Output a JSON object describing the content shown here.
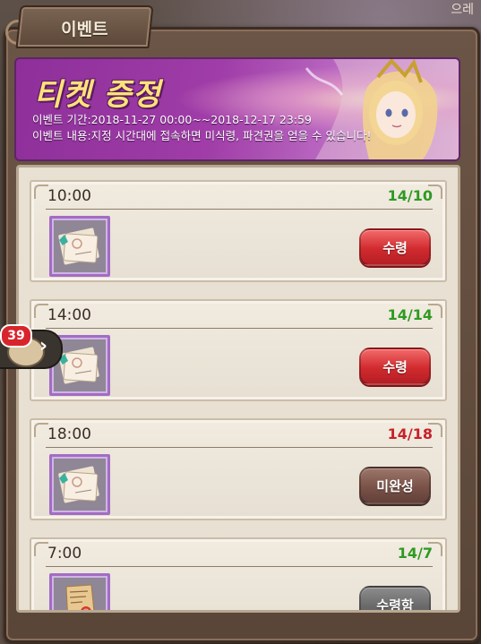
{
  "header": {
    "tab_title": "이벤트",
    "corner_text": "으레"
  },
  "banner": {
    "title": "티켓 증정",
    "period": "이벤트 기간:2018-11-27 00:00~~2018-12-17 23:59",
    "description": "이벤트 내용:지정 시간대에 접속하면 미식령, 파견권을 얻을 수 있습니다!"
  },
  "side": {
    "badge_count": "39",
    "arrow": "›"
  },
  "rewards": [
    {
      "time": "10:00",
      "progress": "14/10",
      "progress_color": "#2e9a22",
      "button": "수령",
      "button_style": "red",
      "item": "ticket"
    },
    {
      "time": "14:00",
      "progress": "14/14",
      "progress_color": "#2e9a22",
      "button": "수령",
      "button_style": "red",
      "item": "ticket"
    },
    {
      "time": "18:00",
      "progress": "14/18",
      "progress_color": "#c8202a",
      "button": "미완성",
      "button_style": "brown",
      "item": "ticket"
    },
    {
      "time": "7:00",
      "progress": "14/7",
      "progress_color": "#2e9a22",
      "button": "수령함",
      "button_style": "gray",
      "item": "scroll"
    }
  ],
  "colors": {
    "banner_purple": "#a03da8",
    "title_gold": "#ffe27a",
    "frame_brown": "#6b5546"
  }
}
